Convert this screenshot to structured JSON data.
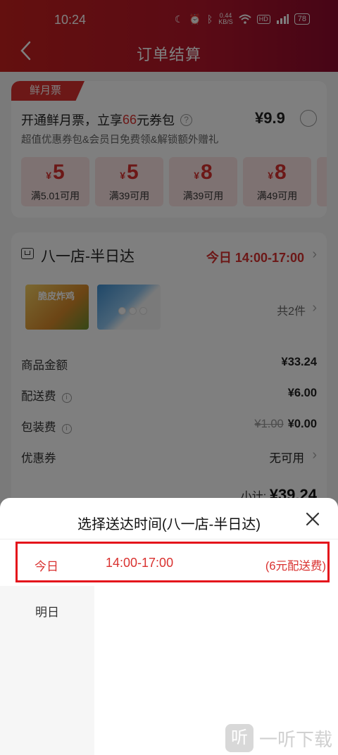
{
  "status_bar": {
    "time": "10:24",
    "net_speed_value": "0.44",
    "net_speed_unit": "KB/S",
    "hd_label": "HD",
    "battery": "78"
  },
  "header": {
    "title": "订单结算"
  },
  "promo": {
    "tag": "鲜月票",
    "line_prefix": "开通鲜月票，立享",
    "line_highlight": "66",
    "line_suffix": "元券包",
    "price": "¥9.9",
    "subtitle": "超值优惠券包&会员日免费领&解锁额外赠礼",
    "coupons": [
      {
        "amount": "5",
        "condition": "满5.01可用"
      },
      {
        "amount": "5",
        "condition": "满39可用"
      },
      {
        "amount": "8",
        "condition": "满39可用"
      },
      {
        "amount": "8",
        "condition": "满49可用"
      }
    ],
    "currency": "¥"
  },
  "order": {
    "store": "八一店-半日达",
    "delivery_time": "今日 14:00-17:00",
    "product_1_label": "脆皮炸鸡",
    "item_count": "共2件",
    "rows": {
      "goods_label": "商品金额",
      "goods_value": "¥33.24",
      "delivery_label": "配送费",
      "delivery_value": "¥6.00",
      "packing_label": "包装费",
      "packing_original": "¥1.00",
      "packing_value": "¥0.00",
      "coupon_label": "优惠券",
      "coupon_value": "无可用"
    },
    "subtotal_label": "小计:",
    "subtotal_value": "¥39.24"
  },
  "sheet": {
    "title": "选择送达时间(八一店-半日达)",
    "selected_day": "今日",
    "slot_time": "14:00-17:00",
    "slot_fee": "(6元配送费)",
    "other_day": "明日"
  },
  "watermark": {
    "logo": "听",
    "text": "一听下载"
  },
  "colors": {
    "brand_red": "#d9312f",
    "header_dark": "#8e0a2c",
    "highlight_border": "#e4131b"
  }
}
